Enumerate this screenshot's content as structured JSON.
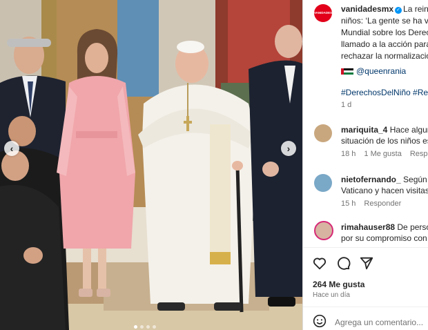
{
  "post": {
    "account": "vanidadesmx",
    "avatar_text": "VANIDADES",
    "caption_lines": [
      "La reina",
      "niños: ‘La gente se ha vu",
      "Mundial sobre los Derec",
      "llamado a la acción para",
      "rechazar la normalizació"
    ],
    "mention": "@queenrania",
    "hashtags": "#DerechosDelNiño #Rein",
    "age": "1 d"
  },
  "comments": [
    {
      "user": "mariquita_4",
      "text_lines": [
        "Hace algune",
        "situación de los niños es"
      ],
      "age": "18 h",
      "likes": "1 Me gusta",
      "reply": "Respond"
    },
    {
      "user": "nietofernando_",
      "text_lines": [
        "Según e",
        "Vaticano y hacen visitas c"
      ],
      "age": "15 h",
      "reply": "Responder"
    },
    {
      "user": "rimahauser88",
      "text_lines": [
        "De person",
        "por su compromiso con"
      ]
    }
  ],
  "footer": {
    "likes": "264 Me gusta",
    "when": "Hace un día",
    "comment_placeholder": "Agrega un comentario..."
  },
  "colors": {
    "brand_red": "#e2001a",
    "link": "#00376b",
    "verified": "#0095f6"
  }
}
